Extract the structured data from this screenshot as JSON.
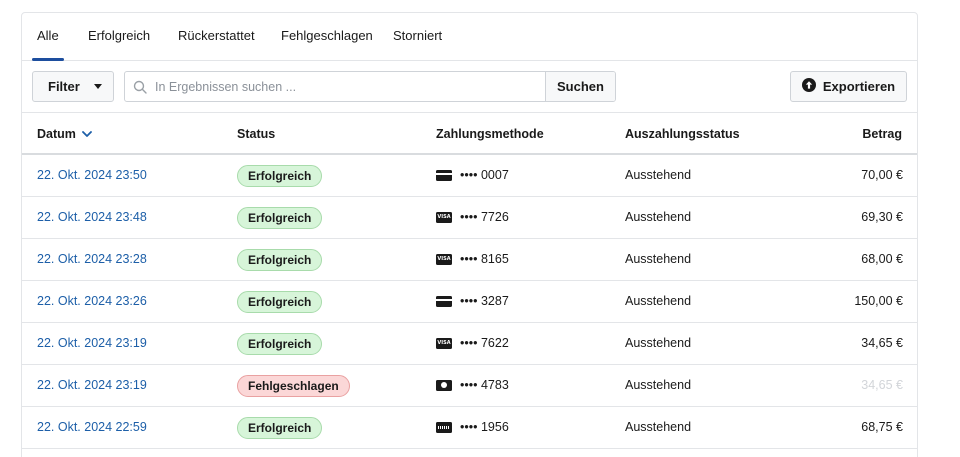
{
  "tabs": [
    {
      "label": "Alle",
      "active": true
    },
    {
      "label": "Erfolgreich",
      "active": false
    },
    {
      "label": "Rückerstattet",
      "active": false
    },
    {
      "label": "Fehlgeschlagen",
      "active": false
    },
    {
      "label": "Storniert",
      "active": false
    }
  ],
  "toolbar": {
    "filter_label": "Filter",
    "search_placeholder": "In Ergebnissen suchen ...",
    "search_value": "",
    "search_button": "Suchen",
    "export_label": "Exportieren"
  },
  "table": {
    "headers": {
      "date": "Datum",
      "status": "Status",
      "payment_method": "Zahlungsmethode",
      "payout_status": "Auszahlungsstatus",
      "amount": "Betrag"
    },
    "sort_icon": "chevron-down-icon",
    "rows": [
      {
        "date": "22. Okt. 2024 23:50",
        "status": "Erfolgreich",
        "status_type": "ok",
        "card_brand": "generic",
        "card_last4": "•••• 0007",
        "payout": "Ausstehend",
        "amount": "70,00 €",
        "amount_muted": false
      },
      {
        "date": "22. Okt. 2024 23:48",
        "status": "Erfolgreich",
        "status_type": "ok",
        "card_brand": "visa",
        "card_last4": "•••• 7726",
        "payout": "Ausstehend",
        "amount": "69,30 €",
        "amount_muted": false
      },
      {
        "date": "22. Okt. 2024 23:28",
        "status": "Erfolgreich",
        "status_type": "ok",
        "card_brand": "visa",
        "card_last4": "•••• 8165",
        "payout": "Ausstehend",
        "amount": "68,00 €",
        "amount_muted": false
      },
      {
        "date": "22. Okt. 2024 23:26",
        "status": "Erfolgreich",
        "status_type": "ok",
        "card_brand": "generic",
        "card_last4": "•••• 3287",
        "payout": "Ausstehend",
        "amount": "150,00 €",
        "amount_muted": false
      },
      {
        "date": "22. Okt. 2024 23:19",
        "status": "Erfolgreich",
        "status_type": "ok",
        "card_brand": "visa",
        "card_last4": "•••• 7622",
        "payout": "Ausstehend",
        "amount": "34,65 €",
        "amount_muted": false
      },
      {
        "date": "22. Okt. 2024 23:19",
        "status": "Fehlgeschlagen",
        "status_type": "fail",
        "card_brand": "mc",
        "card_last4": "•••• 4783",
        "payout": "Ausstehend",
        "amount": "34,65 €",
        "amount_muted": true
      },
      {
        "date": "22. Okt. 2024 22:59",
        "status": "Erfolgreich",
        "status_type": "ok",
        "card_brand": "amex",
        "card_last4": "•••• 1956",
        "payout": "Ausstehend",
        "amount": "68,75 €",
        "amount_muted": false
      }
    ]
  },
  "colors": {
    "accent": "#1d4e9e",
    "link": "#1d5fa8",
    "success_bg": "#d7f5d9",
    "fail_bg": "#fbd7d7"
  }
}
